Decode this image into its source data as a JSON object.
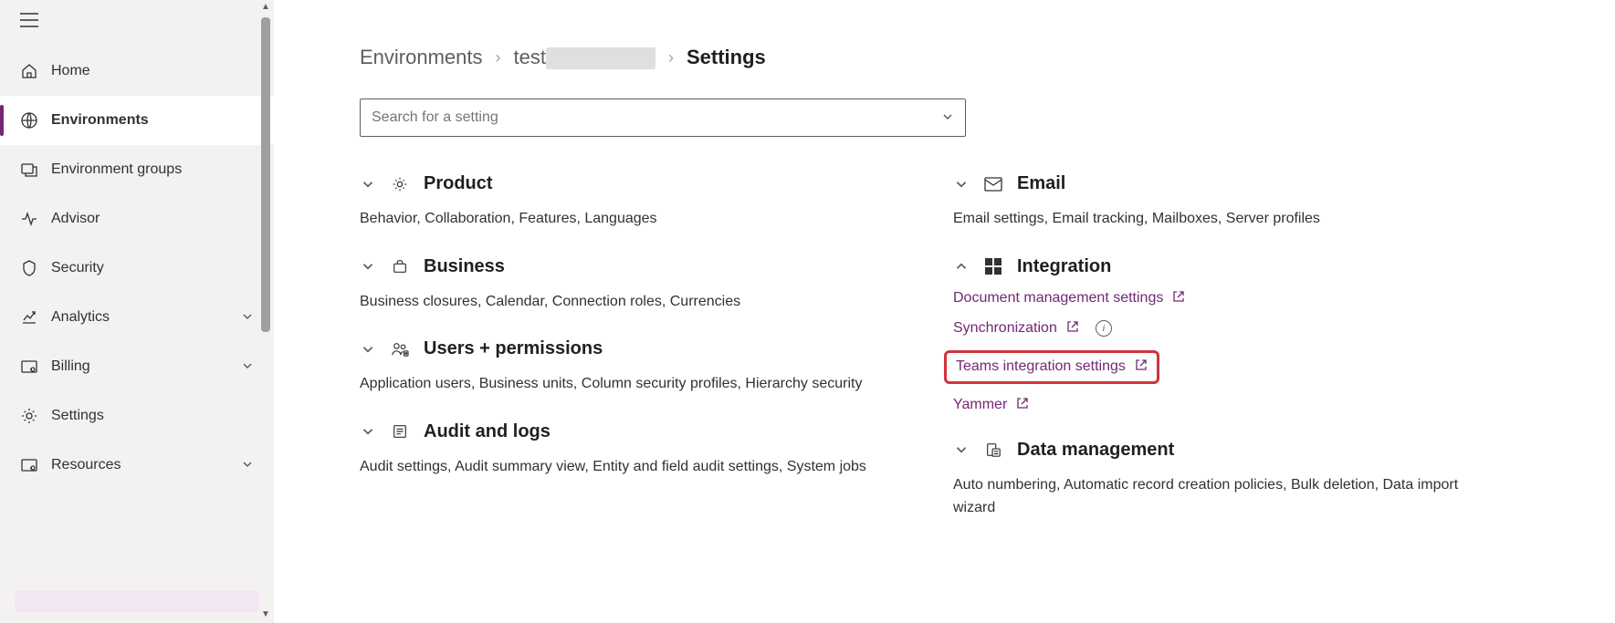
{
  "sidebar": {
    "items": [
      {
        "label": "Home",
        "expandable": false
      },
      {
        "label": "Environments",
        "expandable": false
      },
      {
        "label": "Environment groups",
        "expandable": false
      },
      {
        "label": "Advisor",
        "expandable": false
      },
      {
        "label": "Security",
        "expandable": false
      },
      {
        "label": "Analytics",
        "expandable": true
      },
      {
        "label": "Billing",
        "expandable": true
      },
      {
        "label": "Settings",
        "expandable": false
      },
      {
        "label": "Resources",
        "expandable": true
      }
    ]
  },
  "breadcrumb": {
    "root": "Environments",
    "env": "test",
    "current": "Settings"
  },
  "search": {
    "placeholder": "Search for a setting"
  },
  "categories": {
    "product": {
      "title": "Product",
      "subtitle": "Behavior, Collaboration, Features, Languages"
    },
    "business": {
      "title": "Business",
      "subtitle": "Business closures, Calendar, Connection roles, Currencies"
    },
    "users": {
      "title": "Users + permissions",
      "subtitle": "Application users, Business units, Column security profiles, Hierarchy security"
    },
    "audit": {
      "title": "Audit and logs",
      "subtitle": "Audit settings, Audit summary view, Entity and field audit settings, System jobs"
    },
    "email": {
      "title": "Email",
      "subtitle": "Email settings, Email tracking, Mailboxes, Server profiles"
    },
    "integration": {
      "title": "Integration",
      "links": {
        "doc": "Document management settings",
        "sync": "Synchronization",
        "teams": "Teams integration settings",
        "yammer": "Yammer"
      }
    },
    "data": {
      "title": "Data management",
      "subtitle": "Auto numbering, Automatic record creation policies, Bulk deletion, Data import wizard"
    }
  }
}
